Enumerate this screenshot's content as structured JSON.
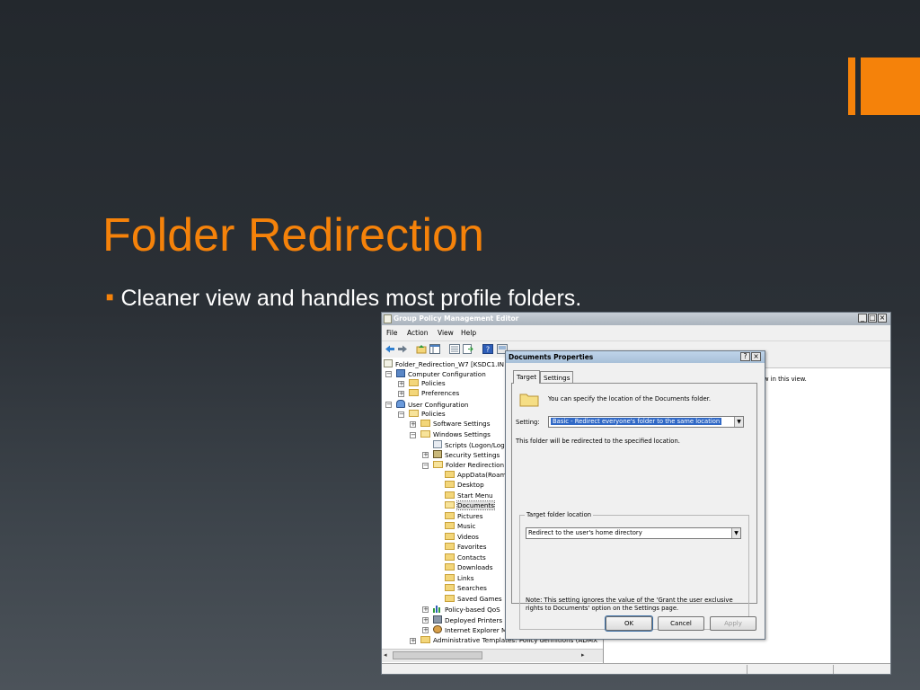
{
  "slide": {
    "title": "Folder Redirection",
    "bullet": "Cleaner view and handles most profile folders."
  },
  "colors": {
    "accent": "#f5820a",
    "background": "#262b30",
    "text": "#ffffff"
  },
  "window": {
    "title": "Group Policy Management Editor",
    "controls": [
      "_",
      "□",
      "×"
    ],
    "menu": [
      "File",
      "Action",
      "View",
      "Help"
    ],
    "toolbar_icons": [
      "back-icon",
      "forward-icon",
      "up-folder-icon",
      "show-hide-tree-icon",
      "properties-icon",
      "export-list-icon",
      "help-icon",
      "console-icon"
    ],
    "tree": [
      {
        "label": "Folder_Redirection_W7 [KSDC1.IN",
        "icon": "policy-icon",
        "expander": ""
      },
      {
        "label": "Computer Configuration",
        "icon": "computer-icon",
        "expander": "−"
      },
      {
        "label": "Policies",
        "icon": "folder-icon",
        "expander": "+"
      },
      {
        "label": "Preferences",
        "icon": "folder-icon",
        "expander": "+"
      },
      {
        "label": "User Configuration",
        "icon": "users-icon",
        "expander": "−"
      },
      {
        "label": "Policies",
        "icon": "folder-icon",
        "expander": "−"
      },
      {
        "label": "Software Settings",
        "icon": "folder-icon",
        "expander": "+"
      },
      {
        "label": "Windows Settings",
        "icon": "folder-icon",
        "expander": "−"
      },
      {
        "label": "Scripts (Logon/Logo",
        "icon": "script-icon",
        "expander": ""
      },
      {
        "label": "Security Settings",
        "icon": "security-icon",
        "expander": "+"
      },
      {
        "label": "Folder Redirection",
        "icon": "folder-icon",
        "expander": "−"
      },
      {
        "label": "AppData(Roam",
        "icon": "folder-icon",
        "expander": ""
      },
      {
        "label": "Desktop",
        "icon": "folder-icon",
        "expander": ""
      },
      {
        "label": "Start Menu",
        "icon": "folder-icon",
        "expander": ""
      },
      {
        "label": "Documents",
        "icon": "folder-icon",
        "expander": ""
      },
      {
        "label": "Pictures",
        "icon": "folder-icon",
        "expander": ""
      },
      {
        "label": "Music",
        "icon": "folder-icon",
        "expander": ""
      },
      {
        "label": "Videos",
        "icon": "folder-icon",
        "expander": ""
      },
      {
        "label": "Favorites",
        "icon": "folder-icon",
        "expander": ""
      },
      {
        "label": "Contacts",
        "icon": "folder-icon",
        "expander": ""
      },
      {
        "label": "Downloads",
        "icon": "folder-icon",
        "expander": ""
      },
      {
        "label": "Links",
        "icon": "folder-icon",
        "expander": ""
      },
      {
        "label": "Searches",
        "icon": "folder-icon",
        "expander": ""
      },
      {
        "label": "Saved Games",
        "icon": "folder-icon",
        "expander": ""
      },
      {
        "label": "Policy-based QoS",
        "icon": "chart-icon",
        "expander": "+"
      },
      {
        "label": "Deployed Printers",
        "icon": "printer-icon",
        "expander": "+"
      },
      {
        "label": "Internet Explorer M",
        "icon": "gear-icon",
        "expander": "+"
      },
      {
        "label": "Administrative Templates: Policy definitions (ADMX",
        "icon": "folder-icon",
        "expander": "+"
      }
    ],
    "right_pane_text": "w in this view."
  },
  "dialog": {
    "title": "Documents Properties",
    "controls": [
      "?",
      "×"
    ],
    "tabs": [
      "Target",
      "Settings"
    ],
    "info_text": "You can specify the location of the Documents folder.",
    "setting_label": "Setting:",
    "setting_value": "Basic - Redirect everyone's folder to the same location",
    "redirect_text": "This folder will be redirected to the specified location.",
    "group_label": "Target folder location",
    "target_value": "Redirect to the user's home directory",
    "note_line1": "Note: This setting ignores the value of the 'Grant the user exclusive",
    "note_line2": "rights to Documents' option on the Settings page.",
    "buttons": {
      "ok": "OK",
      "cancel": "Cancel",
      "apply": "Apply"
    }
  }
}
